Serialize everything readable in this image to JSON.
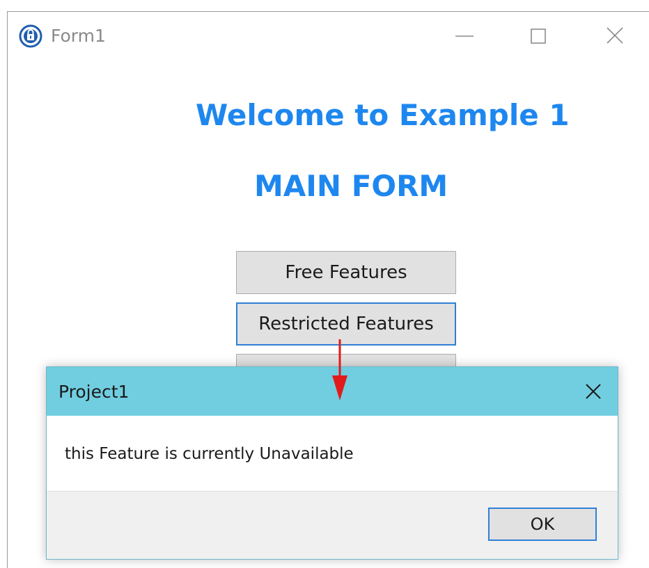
{
  "main_window": {
    "title": "Form1",
    "icon": "lock-app-icon",
    "controls": [
      "minimize-icon",
      "maximize-icon",
      "close-icon"
    ]
  },
  "form": {
    "welcome_heading": "Welcome to Example 1",
    "main_heading": "MAIN FORM",
    "buttons": [
      {
        "label": "Free Features"
      },
      {
        "label": "Restricted Features"
      },
      {
        "label": ""
      }
    ],
    "heading_color": "#1e87ef"
  },
  "dialog": {
    "title": "Project1",
    "message": "this Feature is currently Unavailable",
    "ok_label": "OK",
    "titlebar_color": "#71cee0"
  },
  "annotation": {
    "arrow_color": "#e11b1b"
  }
}
